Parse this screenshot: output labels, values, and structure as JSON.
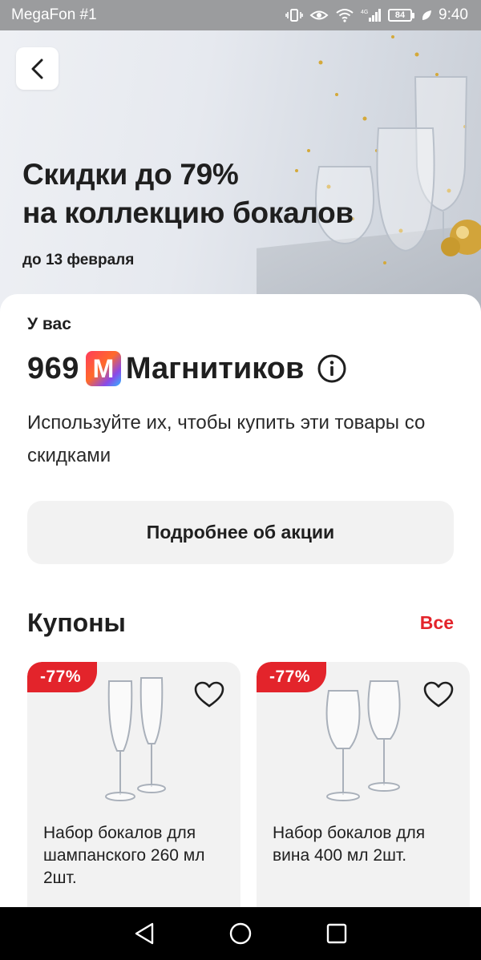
{
  "status_bar": {
    "carrier": "MegaFon #1",
    "battery": "84",
    "time": "9:40"
  },
  "hero": {
    "title": "Скидки до 79%\nна коллекцию бокалов",
    "date": "до 13 февраля"
  },
  "points": {
    "intro": "У вас",
    "value": "969",
    "badge_letter": "М",
    "label": "Магнитиков",
    "description": "Используйте их, чтобы купить эти товары со скидками"
  },
  "details_button": "Подробнее об акции",
  "coupons": {
    "title": "Купоны",
    "all_link": "Все",
    "items": [
      {
        "discount": "-77%",
        "name": "Набор бокалов для шампанского 260 мл 2шт."
      },
      {
        "discount": "-77%",
        "name": "Набор бокалов для вина 400 мл 2шт."
      }
    ]
  },
  "colors": {
    "accent_red": "#e3242b",
    "card_bg": "#f2f2f2"
  },
  "icons": {
    "back": "chevron-left-icon",
    "info": "info-circle-icon",
    "favorite": "heart-outline-icon",
    "nav_back": "triangle-back-icon",
    "nav_home": "circle-home-icon",
    "nav_recents": "square-recents-icon"
  }
}
